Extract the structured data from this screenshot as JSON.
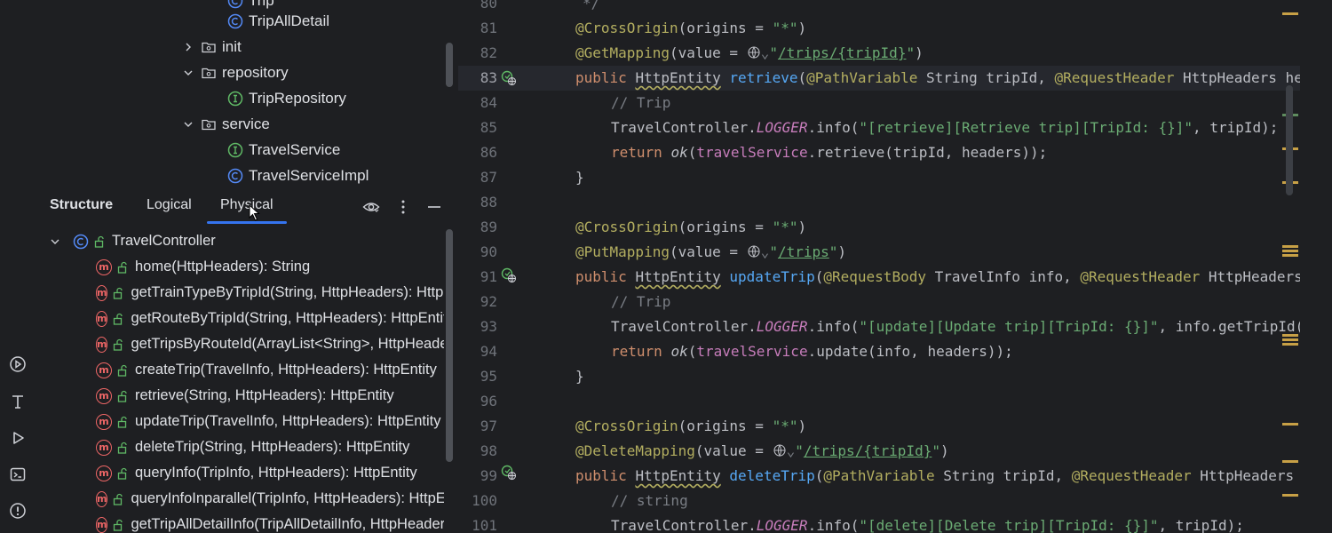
{
  "project_tree": {
    "items": [
      {
        "label": "Trip",
        "type": "class",
        "expanded": null
      },
      {
        "label": "TripAllDetail",
        "type": "class",
        "expanded": null
      },
      {
        "label": "init",
        "type": "package",
        "expanded": false
      },
      {
        "label": "repository",
        "type": "package",
        "expanded": true
      },
      {
        "label": "TripRepository",
        "type": "interface",
        "expanded": null
      },
      {
        "label": "service",
        "type": "package",
        "expanded": true
      },
      {
        "label": "TravelService",
        "type": "interface",
        "expanded": null
      },
      {
        "label": "TravelServiceImpl",
        "type": "class",
        "expanded": null
      }
    ]
  },
  "structure": {
    "title": "Structure",
    "tabs": [
      "Logical",
      "Physical"
    ],
    "active_tab": "Physical",
    "root": "TravelController",
    "members": [
      "home(HttpHeaders): String",
      "getTrainTypeByTripId(String, HttpHeaders): HttpEntity",
      "getRouteByTripId(String, HttpHeaders): HttpEntity",
      "getTripsByRouteId(ArrayList<String>, HttpHeaders): HttpEntity",
      "createTrip(TravelInfo, HttpHeaders): HttpEntity",
      "retrieve(String, HttpHeaders): HttpEntity",
      "updateTrip(TravelInfo, HttpHeaders): HttpEntity",
      "deleteTrip(String, HttpHeaders): HttpEntity",
      "queryInfo(TripInfo, HttpHeaders): HttpEntity",
      "queryInfoInparallel(TripInfo, HttpHeaders): HttpEntity",
      "getTripAllDetailInfo(TripAllDetailInfo, HttpHeaders): HttpEntity"
    ]
  },
  "editor": {
    "current_line": 83,
    "line_numbers": [
      "80",
      "81",
      "82",
      "83",
      "84",
      "85",
      "86",
      "87",
      "88",
      "89",
      "90",
      "91",
      "92",
      "93",
      "94",
      "95",
      "96",
      "97",
      "98",
      "99",
      "100",
      "101"
    ],
    "lines": {
      "l80": "*/",
      "l81_ann": "@CrossOrigin",
      "l81_a": "(origins = ",
      "l81_s": "\"*\"",
      "l81_b": ")",
      "l82_ann": "@GetMapping",
      "l82_a": "(value = ",
      "l82_q": "\"",
      "l82_link": "/trips/{tripId}",
      "l82_q2": "\"",
      "l82_b": ")",
      "l83_kw": "public",
      "l83_t": "HttpEntity",
      "l83_fn": "retrieve",
      "l83_p": "(",
      "l83_ann": "@PathVariable",
      "l83_c": " String tripId, ",
      "l83_ann2": "@RequestHeader",
      "l83_d": " HttpHeaders headers) {",
      "l84": "// Trip",
      "l85_a": "TravelController.",
      "l85_st": "LOGGER",
      "l85_b": ".info(",
      "l85_s": "\"[retrieve][Retrieve trip][TripId: {}]\"",
      "l85_c": ", tripId);",
      "l86_kw": "return",
      "l86_it": "ok",
      "l86_a": "(",
      "l86_f": "travelService",
      "l86_b": ".retrieve(tripId, headers));",
      "l87": "}",
      "l89_ann": "@CrossOrigin",
      "l89_a": "(origins = ",
      "l89_s": "\"*\"",
      "l89_b": ")",
      "l90_ann": "@PutMapping",
      "l90_a": "(value = ",
      "l90_q": "\"",
      "l90_link": "/trips",
      "l90_q2": "\"",
      "l90_b": ")",
      "l91_kw": "public",
      "l91_t": "HttpEntity",
      "l91_fn": "updateTrip",
      "l91_p": "(",
      "l91_ann": "@RequestBody",
      "l91_c": " TravelInfo info, ",
      "l91_ann2": "@RequestHeader",
      "l91_d": " HttpHeaders headers) {",
      "l92": "// Trip",
      "l93_a": "TravelController.",
      "l93_st": "LOGGER",
      "l93_b": ".info(",
      "l93_s": "\"[update][Update trip][TripId: {}]\"",
      "l93_c": ", info.getTripId());",
      "l94_kw": "return",
      "l94_it": "ok",
      "l94_a": "(",
      "l94_f": "travelService",
      "l94_b": ".update(info, headers));",
      "l95": "}",
      "l97_ann": "@CrossOrigin",
      "l97_a": "(origins = ",
      "l97_s": "\"*\"",
      "l97_b": ")",
      "l98_ann": "@DeleteMapping",
      "l98_a": "(value = ",
      "l98_q": "\"",
      "l98_link": "/trips/{tripId}",
      "l98_q2": "\"",
      "l98_b": ")",
      "l99_kw": "public",
      "l99_t": "HttpEntity",
      "l99_fn": "deleteTrip",
      "l99_p": "(",
      "l99_ann": "@PathVariable",
      "l99_c": " String tripId, ",
      "l99_ann2": "@RequestHeader",
      "l99_d": " HttpHeaders headers) {",
      "l100": "// string",
      "l101_a": "TravelController.",
      "l101_st": "LOGGER",
      "l101_b": ".info(",
      "l101_s": "\"[delete][Delete trip][TripId: {}]\"",
      "l101_c": ", tripId);"
    }
  },
  "colors": {
    "background": "#1e1f22",
    "accent": "#3574f0",
    "keyword": "#cf8e6d",
    "annotation": "#b3ae60",
    "string": "#6aab73",
    "function": "#56a8f5"
  }
}
